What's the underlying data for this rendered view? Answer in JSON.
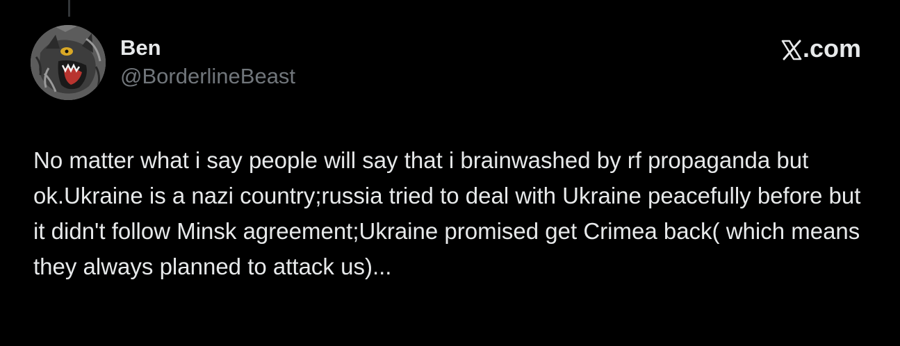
{
  "author": {
    "display_name": "Ben",
    "handle": "@BorderlineBeast",
    "avatar_icon": "wolf-avatar-icon"
  },
  "brand": {
    "label": ".com",
    "logo_icon": "x-logo-icon"
  },
  "tweet": {
    "text": "No matter what i say people will say that i brainwashed by rf propaganda but ok.Ukraine is a nazi country;russia tried to deal with Ukraine peacefully before but it didn't follow Minsk agreement;Ukraine promised get Crimea back( which means they always planned to attack us)..."
  },
  "colors": {
    "background": "#000000",
    "primary_text": "#e7e9ea",
    "secondary_text": "#71767b",
    "thread_line": "#333639"
  }
}
